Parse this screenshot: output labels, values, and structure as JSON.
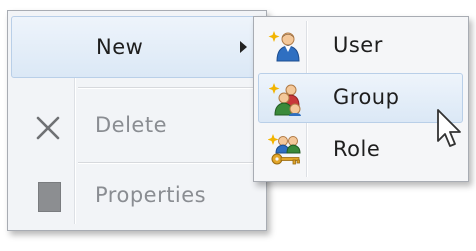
{
  "context_menu": {
    "items": [
      {
        "label": "New",
        "icon": "none",
        "has_submenu": true,
        "state": "highlighted"
      },
      {
        "label": "Delete",
        "icon": "delete-x-icon",
        "state": "disabled"
      },
      {
        "label": "Properties",
        "icon": "properties-icon",
        "state": "disabled"
      }
    ]
  },
  "submenu": {
    "items": [
      {
        "label": "User",
        "icon": "new-user-icon"
      },
      {
        "label": "Group",
        "icon": "new-group-icon",
        "state": "hovered"
      },
      {
        "label": "Role",
        "icon": "new-role-icon"
      }
    ]
  },
  "colors": {
    "highlight": "#dbe8f6",
    "highlight_border": "#b9cfe8",
    "menu_background": "#f2f4f7",
    "disabled_text": "#8a8d92"
  }
}
